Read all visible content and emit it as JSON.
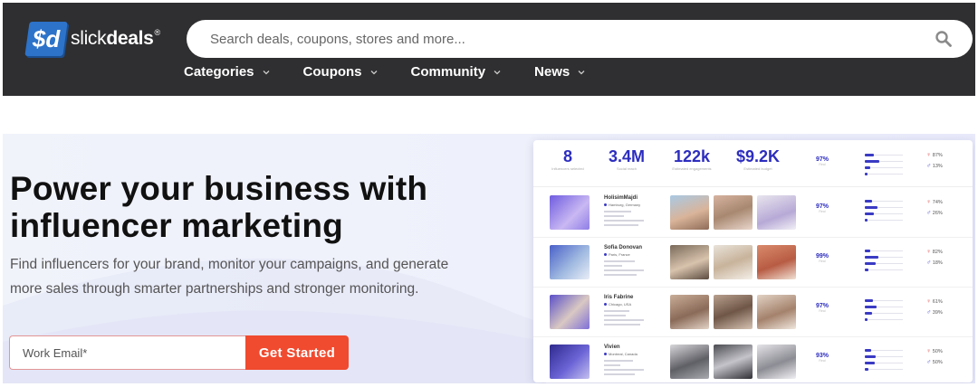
{
  "header": {
    "logo": {
      "mark": "$d",
      "text_regular": "slick",
      "text_bold": "deals",
      "reg": "®"
    },
    "search": {
      "placeholder": "Search deals, coupons, stores and more..."
    },
    "nav": [
      {
        "label": "Categories"
      },
      {
        "label": "Coupons"
      },
      {
        "label": "Community"
      },
      {
        "label": "News"
      }
    ]
  },
  "hero": {
    "headline_line1": "Power your business with",
    "headline_line2": "influencer marketing",
    "subtext": "Find influencers for your brand, monitor your campaigns, and generate more sales through smarter partnerships and stronger monitoring.",
    "email": {
      "placeholder": "Work Email*"
    },
    "cta_label": "Get Started"
  },
  "dashboard": {
    "stats": [
      {
        "value": "8",
        "label": "Influencers selected"
      },
      {
        "value": "3.4M",
        "label": "Social reach"
      },
      {
        "value": "122k",
        "label": "Estimated engagements"
      },
      {
        "value": "$9.2K",
        "label": "Estimated budget"
      }
    ],
    "summary": {
      "quality": "97%",
      "quality_label": "Real",
      "female": "87%",
      "male": "13%"
    },
    "influencers": [
      {
        "name": "HolisimMajdi",
        "location": "Hamburg, Germany",
        "quality": "97%",
        "quality_label": "Real",
        "female": "74%",
        "male": "26%"
      },
      {
        "name": "Sofia Donovan",
        "location": "Paris, France",
        "quality": "99%",
        "quality_label": "Real",
        "female": "82%",
        "male": "18%"
      },
      {
        "name": "Iris Fabrine",
        "location": "Chicago, USA",
        "quality": "97%",
        "quality_label": "Real",
        "female": "61%",
        "male": "39%"
      },
      {
        "name": "Vivien",
        "location": "Montreal, Canada",
        "quality": "93%",
        "quality_label": "Real",
        "female": "50%",
        "male": "50%"
      }
    ],
    "colors": {
      "accent": "#2d2dbf",
      "cta": "#f04a2f",
      "header_bg": "#2f2f31",
      "logo_blue": "#2d73c9"
    }
  }
}
